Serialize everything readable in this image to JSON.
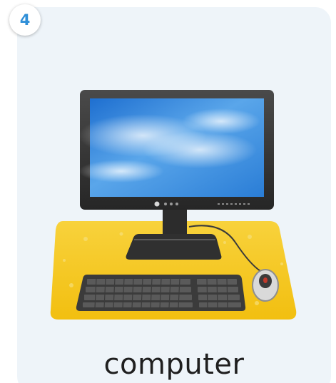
{
  "badge": {
    "number": "4"
  },
  "card": {
    "label": "computer"
  },
  "illustration": {
    "icon": "computer-icon"
  }
}
